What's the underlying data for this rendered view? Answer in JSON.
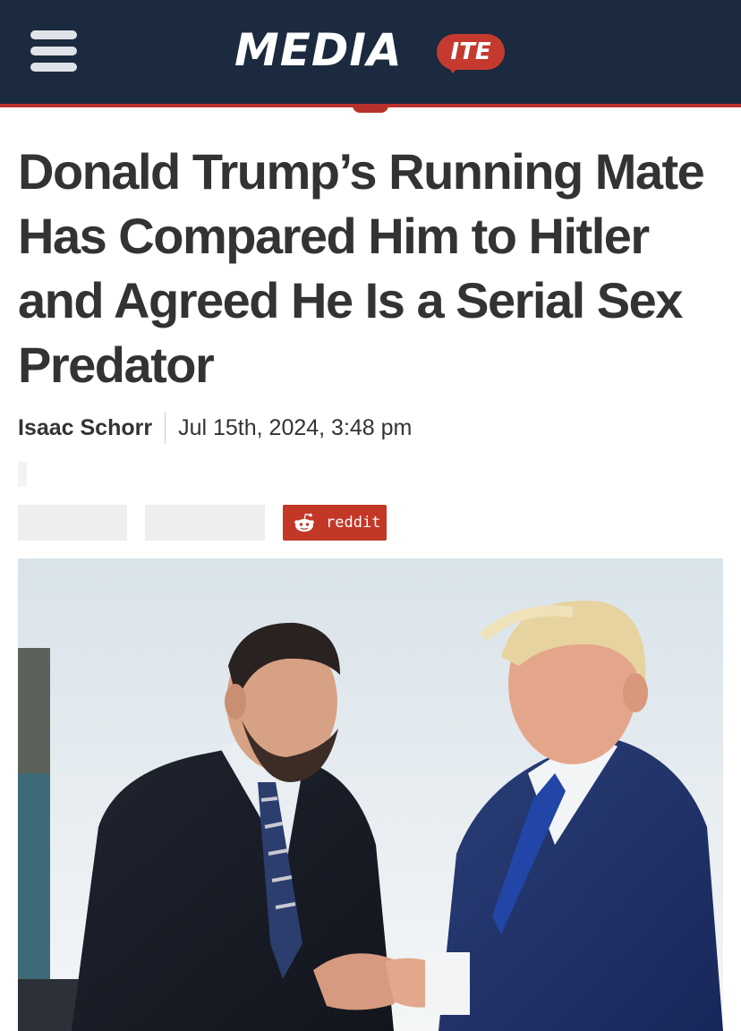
{
  "header": {
    "menu_icon": "hamburger-menu-icon",
    "logo_main": "MEDIA",
    "logo_badge": "ITE"
  },
  "article": {
    "headline": "Donald Trump’s Running Mate Has Compared Him to Hitler and Agreed He Is a Serial Sex Predator",
    "author": "Isaac Schorr",
    "date": "Jul 15th, 2024, 3:48 pm"
  },
  "share": {
    "reddit_label": "reddit",
    "reddit_icon": "reddit-alien-icon"
  },
  "colors": {
    "header_bg": "#1b2a3e",
    "accent_red": "#b8312a",
    "reddit_red": "#c33727",
    "headline_text": "#333333"
  }
}
